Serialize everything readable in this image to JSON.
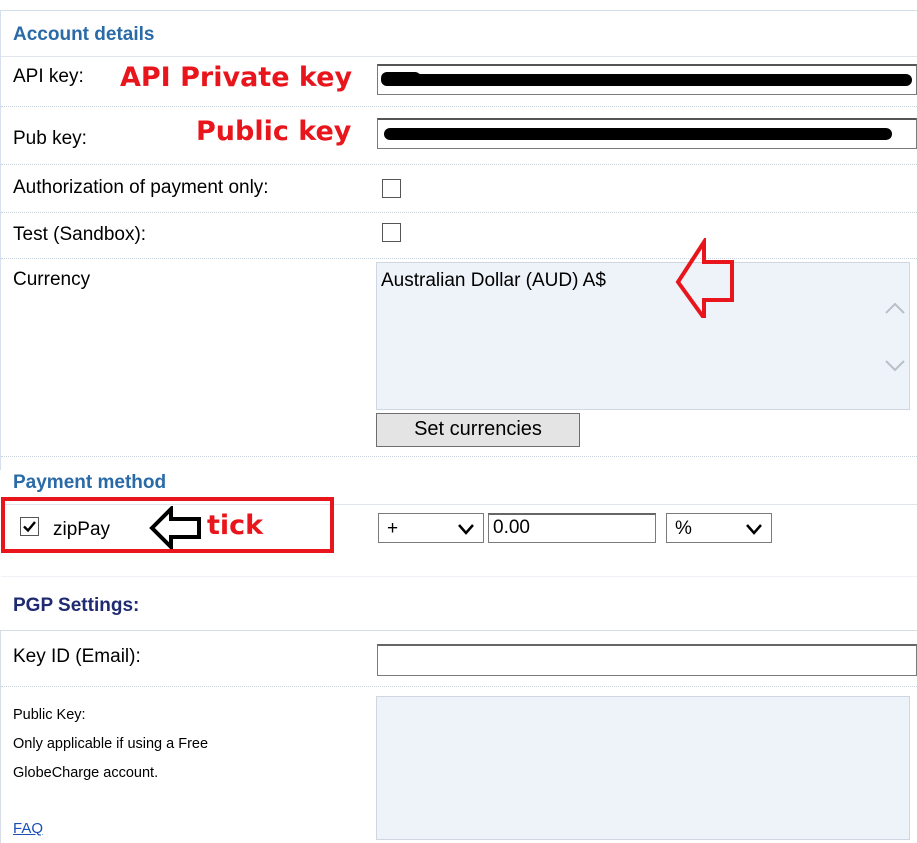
{
  "account": {
    "section_title": "Account details",
    "api_key_label": "API key:",
    "api_key_annotation": "API Private key",
    "pub_key_label": "Pub key:",
    "pub_key_annotation": "Public key",
    "auth_only_label": "Authorization of payment only:",
    "auth_only_checked": false,
    "test_label": "Test (Sandbox):",
    "test_checked": false,
    "currency_label": "Currency",
    "currency_options": [
      "Australian Dollar (AUD) A$"
    ],
    "set_currencies_button": "Set currencies"
  },
  "payment": {
    "section_title": "Payment method",
    "method_label": "zipPay",
    "method_checked": true,
    "tick_annotation": "tick",
    "sign_select": "+",
    "amount_value": "0.00",
    "unit_select": "%"
  },
  "pgp": {
    "section_title": "PGP Settings:",
    "key_id_label": "Key ID (Email):",
    "key_id_value": "",
    "public_key_label": "Public Key:",
    "public_key_note_1": "Only applicable if using a Free",
    "public_key_note_2": "GlobeCharge account.",
    "faq_link": "FAQ"
  },
  "colors": {
    "section_title": "#2a6aa7",
    "annotation_red": "#e8161c",
    "listbox_bg": "#eef2f9"
  }
}
